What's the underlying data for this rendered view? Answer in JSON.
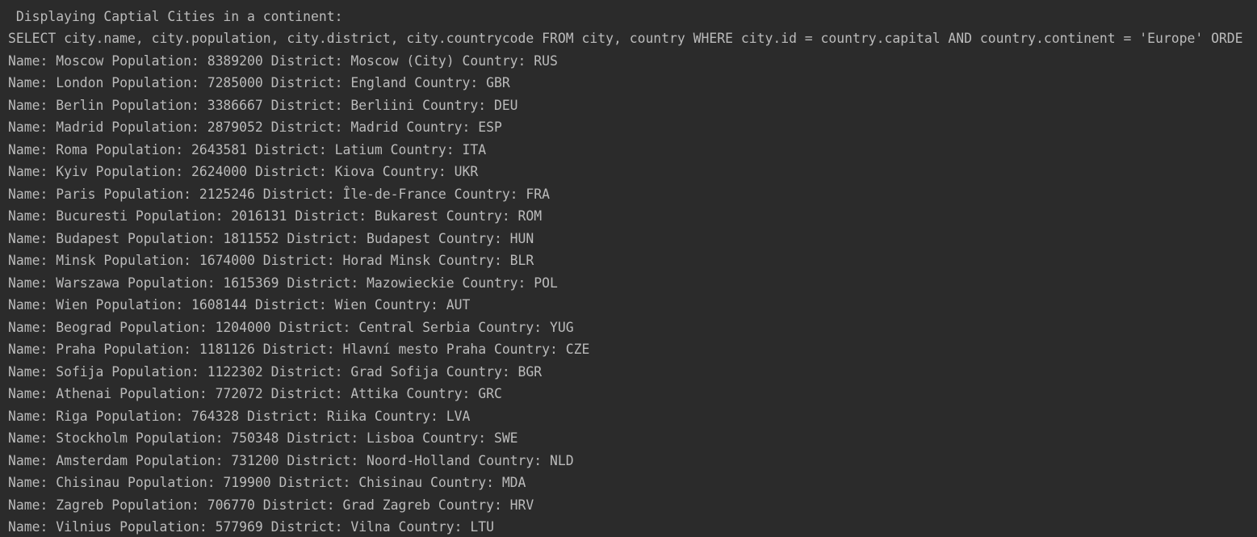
{
  "console": {
    "header": " Displaying Captial Cities in a continent:",
    "query": "SELECT city.name, city.population, city.district, city.countrycode FROM city, country WHERE city.id = country.capital AND country.continent = 'Europe' ORDE",
    "rows": [
      "Name: Moscow Population: 8389200 District: Moscow (City) Country: RUS",
      "Name: London Population: 7285000 District: England Country: GBR",
      "Name: Berlin Population: 3386667 District: Berliini Country: DEU",
      "Name: Madrid Population: 2879052 District: Madrid Country: ESP",
      "Name: Roma Population: 2643581 District: Latium Country: ITA",
      "Name: Kyiv Population: 2624000 District: Kiova Country: UKR",
      "Name: Paris Population: 2125246 District: Île-de-France Country: FRA",
      "Name: Bucuresti Population: 2016131 District: Bukarest Country: ROM",
      "Name: Budapest Population: 1811552 District: Budapest Country: HUN",
      "Name: Minsk Population: 1674000 District: Horad Minsk Country: BLR",
      "Name: Warszawa Population: 1615369 District: Mazowieckie Country: POL",
      "Name: Wien Population: 1608144 District: Wien Country: AUT",
      "Name: Beograd Population: 1204000 District: Central Serbia Country: YUG",
      "Name: Praha Population: 1181126 District: Hlavní mesto Praha Country: CZE",
      "Name: Sofija Population: 1122302 District: Grad Sofija Country: BGR",
      "Name: Athenai Population: 772072 District: Attika Country: GRC",
      "Name: Riga Population: 764328 District: Riika Country: LVA",
      "Name: Stockholm Population: 750348 District: Lisboa Country: SWE",
      "Name: Amsterdam Population: 731200 District: Noord-Holland Country: NLD",
      "Name: Chisinau Population: 719900 District: Chisinau Country: MDA",
      "Name: Zagreb Population: 706770 District: Grad Zagreb Country: HRV",
      "Name: Vilnius Population: 577969 District: Vilna Country: LTU"
    ]
  },
  "colors": {
    "background": "#2b2b2b",
    "text": "#bbbbbb"
  }
}
